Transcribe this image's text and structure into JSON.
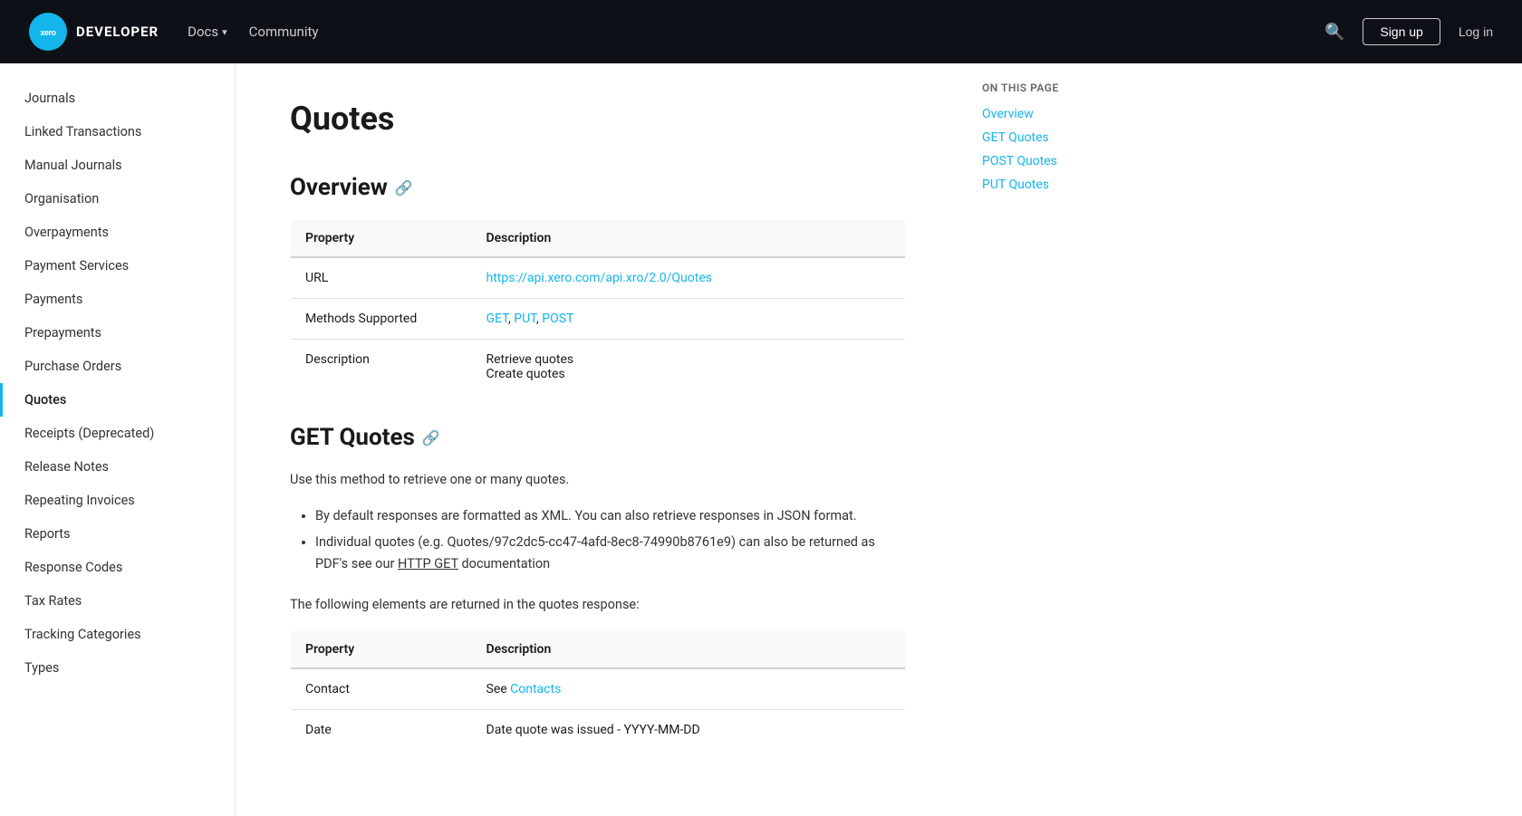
{
  "header": {
    "logo_text": "DEVELOPER",
    "logo_abbr": "xero",
    "nav_items": [
      {
        "label": "Docs",
        "has_dropdown": true
      },
      {
        "label": "Community",
        "has_dropdown": false
      }
    ],
    "search_icon": "🔍",
    "signup_label": "Sign up",
    "login_label": "Log in"
  },
  "sidebar": {
    "items": [
      {
        "label": "Journals",
        "active": false
      },
      {
        "label": "Linked Transactions",
        "active": false
      },
      {
        "label": "Manual Journals",
        "active": false
      },
      {
        "label": "Organisation",
        "active": false
      },
      {
        "label": "Overpayments",
        "active": false
      },
      {
        "label": "Payment Services",
        "active": false
      },
      {
        "label": "Payments",
        "active": false
      },
      {
        "label": "Prepayments",
        "active": false
      },
      {
        "label": "Purchase Orders",
        "active": false
      },
      {
        "label": "Quotes",
        "active": true
      },
      {
        "label": "Receipts (Deprecated)",
        "active": false
      },
      {
        "label": "Release Notes",
        "active": false
      },
      {
        "label": "Repeating Invoices",
        "active": false
      },
      {
        "label": "Reports",
        "active": false
      },
      {
        "label": "Response Codes",
        "active": false
      },
      {
        "label": "Tax Rates",
        "active": false
      },
      {
        "label": "Tracking Categories",
        "active": false
      },
      {
        "label": "Types",
        "active": false
      }
    ]
  },
  "main": {
    "page_title": "Quotes",
    "overview_heading": "Overview",
    "overview_table": {
      "col1": "Property",
      "col2": "Description",
      "rows": [
        {
          "property": "URL",
          "description_text": "",
          "description_link": "https://api.xero.com/api.xro/2.0/Quotes",
          "description_link_label": "https://api.xero.com/api.xro/2.0/Quotes"
        },
        {
          "property": "Methods Supported",
          "description_text": "",
          "description_links": [
            {
              "label": "GET",
              "href": "#get-quotes"
            },
            {
              "label": "PUT",
              "href": "#put-quotes"
            },
            {
              "label": "POST",
              "href": "#post-quotes"
            }
          ]
        },
        {
          "property": "Description",
          "description_lines": [
            "Retrieve quotes",
            "Create quotes"
          ]
        }
      ]
    },
    "get_quotes_heading": "GET Quotes",
    "get_quotes_intro": "Use this method to retrieve one or many quotes.",
    "get_quotes_bullets": [
      "By default responses are formatted as XML. You can also retrieve responses in JSON format.",
      "Individual quotes (e.g. Quotes/97c2dc5-cc47-4afd-8ec8-74990b8761e9) can also be returned as PDF's see our HTTP GET documentation"
    ],
    "get_quotes_elements_text": "The following elements are returned in the quotes response:",
    "get_quotes_table": {
      "col1": "Property",
      "col2": "Description",
      "rows": [
        {
          "property": "Contact",
          "description_text": "See ",
          "description_link_label": "Contacts",
          "description_link": "#contacts"
        },
        {
          "property": "Date",
          "description_text": "Date quote was issued - YYYY-MM-DD"
        }
      ]
    },
    "http_get_label": "HTTP GET",
    "contacts_label": "Contacts"
  },
  "toc": {
    "label": "On this page",
    "items": [
      {
        "label": "Overview",
        "href": "#overview"
      },
      {
        "label": "GET Quotes",
        "href": "#get-quotes"
      },
      {
        "label": "POST Quotes",
        "href": "#post-quotes"
      },
      {
        "label": "PUT Quotes",
        "href": "#put-quotes"
      }
    ]
  }
}
